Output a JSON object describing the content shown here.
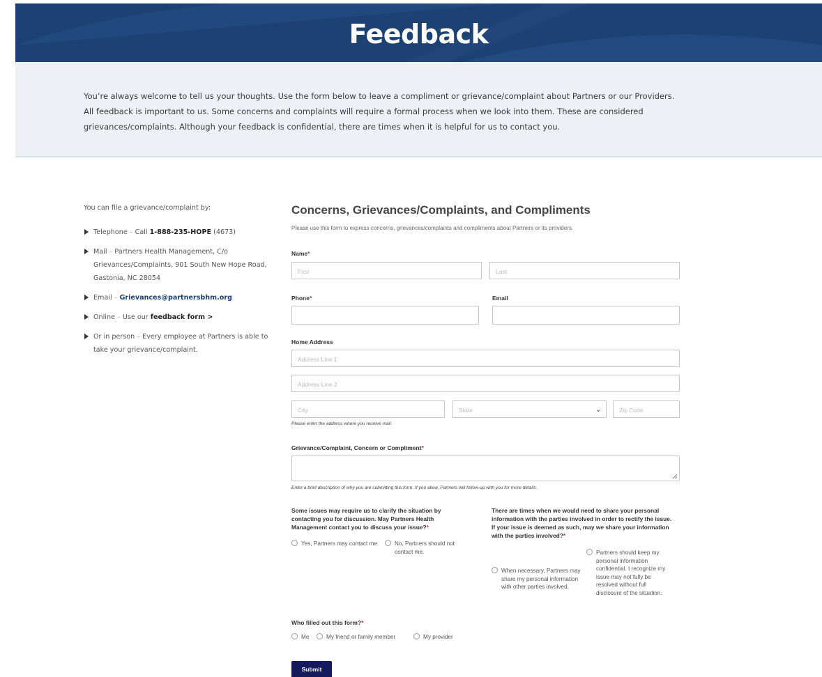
{
  "banner": {
    "title": "Feedback"
  },
  "intro": {
    "text": "You’re always welcome to tell us your thoughts. Use the form below to leave a compliment or grievance/complaint about Partners or our Providers. All feedback is important to us. Some concerns and complaints will require a formal process when we look into them. These are considered grievances/complaints. Although your feedback is confidential, there are times when it is helpful for us to contact you."
  },
  "sidebar": {
    "intro": "You can file a grievance/complaint by:",
    "items": [
      {
        "label": "Telephone",
        "sep": " – ",
        "pre": "Call ",
        "bold": "1-888-235-HOPE",
        "post": " (4673)"
      },
      {
        "label": "Mail",
        "sep": " – ",
        "text": "Partners Health Management, C/o Grievances/Complaints, 901 South New Hope Road, Gastonia, NC 28054"
      },
      {
        "label": "Email",
        "sep": " – ",
        "link": "Grievances@partnersbhm.org"
      },
      {
        "label": "Online",
        "sep": " – ",
        "pre": "Use our ",
        "link": "feedback form >"
      },
      {
        "label": "Or in person",
        "sep": " – ",
        "text": "Every employee at Partners is able to take your grievance/complaint."
      }
    ]
  },
  "form": {
    "title": "Concerns, Grievances/Complaints, and Compliments",
    "subtitle": "Please use this form to express concerns, grievances/complaints and compliments about Partners or its providers.",
    "name_label": "Name",
    "first_placeholder": "First",
    "last_placeholder": "Last",
    "phone_label": "Phone",
    "email_label": "Email",
    "address_label": "Home Address",
    "address1_placeholder": "Address Line 1",
    "address2_placeholder": "Address Line 2",
    "city_placeholder": "City",
    "state_placeholder": "State",
    "zip_placeholder": "Zip Code",
    "address_help": "Please enter the address where you receive mail.",
    "feedback_label": "Grievance/Complaint, Concern or Compliment",
    "feedback_help": "Enter a brief description of why you are submitting this form. If you allow, Partners will follow-up with you for more details.",
    "contact_question": "Some issues may require us to clarify the situation by contacting you for discussion. May Partners Health Management contact you to discuss your issue?",
    "contact_yes": "Yes, Partners may contact me.",
    "contact_no": "No, Partners should not contact me.",
    "share_question": "There are times when we would need to share your personal information with the parties involved in order to rectify the issue. If your issue is deemed as such, may we share your information with the parties involved?",
    "share_yes": "When necessary, Partners may share my personal information with other parties involved.",
    "share_no": "Partners should keep my personal information confidential. I recognize my issue may not fully be resolved without full disclosure of the situation.",
    "filled_question": "Who filled out this form?",
    "filled_options": [
      "Me",
      "My friend or family member",
      "My provider"
    ],
    "required_mark": "*",
    "submit_label": "Submit"
  },
  "colors": {
    "banner": "#1c4273",
    "intro_bg": "#edf1f5",
    "submit": "#141a5c",
    "required": "#c0392b"
  }
}
